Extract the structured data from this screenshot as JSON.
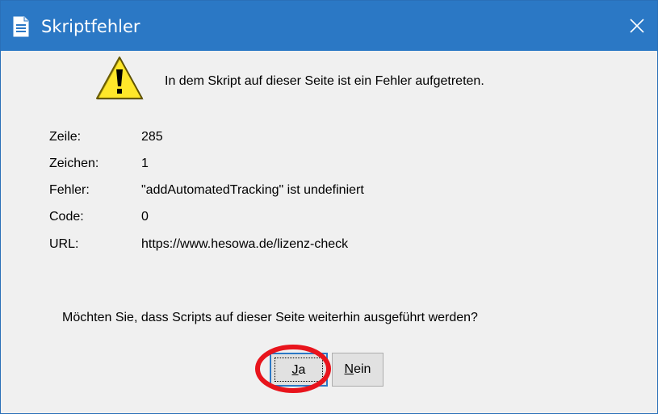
{
  "window": {
    "title": "Skriptfehler",
    "title_icon": "document-icon",
    "close_icon": "close-icon"
  },
  "message": {
    "icon": "warning-icon",
    "text": "In dem Skript auf dieser Seite ist ein Fehler aufgetreten."
  },
  "details": [
    {
      "label": "Zeile:",
      "value": "285"
    },
    {
      "label": "Zeichen:",
      "value": "1"
    },
    {
      "label": "Fehler:",
      "value": "\"addAutomatedTracking\" ist undefiniert"
    },
    {
      "label": "Code:",
      "value": "0"
    },
    {
      "label": "URL:",
      "value": "https://www.hesowa.de/lizenz-check"
    }
  ],
  "question": "Möchten Sie, dass Scripts auf dieser Seite weiterhin ausgeführt werden?",
  "buttons": {
    "yes": {
      "mnemonic": "J",
      "rest": "a"
    },
    "no": {
      "mnemonic": "N",
      "rest": "ein"
    }
  },
  "colors": {
    "titlebar": "#2b78c5",
    "dialog_bg": "#f0f0f0",
    "annotation": "#e8141c"
  }
}
